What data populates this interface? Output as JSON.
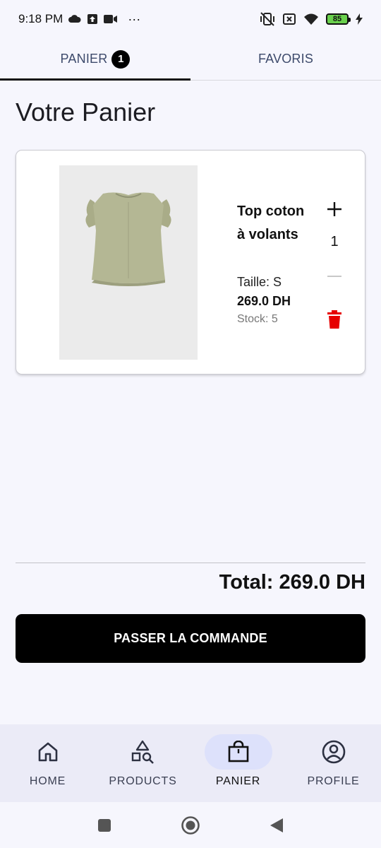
{
  "status_bar": {
    "time": "9:18 PM",
    "dots": "···",
    "battery": "85",
    "left_icons": [
      "cloud-icon",
      "upload-icon",
      "video-icon"
    ],
    "right_icons": [
      "vibrate-off-icon",
      "sim-off-icon",
      "wifi-icon",
      "battery-icon",
      "charging-icon"
    ]
  },
  "tabs": [
    {
      "label": "PANIER",
      "badge": "1",
      "active": true
    },
    {
      "label": "FAVORIS",
      "active": false
    }
  ],
  "page_title": "Votre Panier",
  "cart_items": [
    {
      "name": "Top coton à volants",
      "size": "Taille: S",
      "price": "269.0 DH",
      "stock": "Stock: 5",
      "quantity": "1",
      "image_icon": "ruffle-top-image"
    }
  ],
  "total": "Total: 269.0 DH",
  "checkout_label": "PASSER LA COMMANDE",
  "bottom_nav": [
    {
      "label": "HOME",
      "icon": "home-icon",
      "active": false
    },
    {
      "label": "PRODUCTS",
      "icon": "shapes-search-icon",
      "active": false
    },
    {
      "label": "PANIER",
      "icon": "shopping-bag-icon",
      "active": true
    },
    {
      "label": "PROFILE",
      "icon": "profile-icon",
      "active": false
    }
  ],
  "colors": {
    "background": "#f6f6fd",
    "accent": "#000000",
    "delete": "#e60000",
    "tab_text": "#3d4a6b",
    "nav_active_pill": "#dde1fb",
    "nav_background": "#ebebf7"
  }
}
